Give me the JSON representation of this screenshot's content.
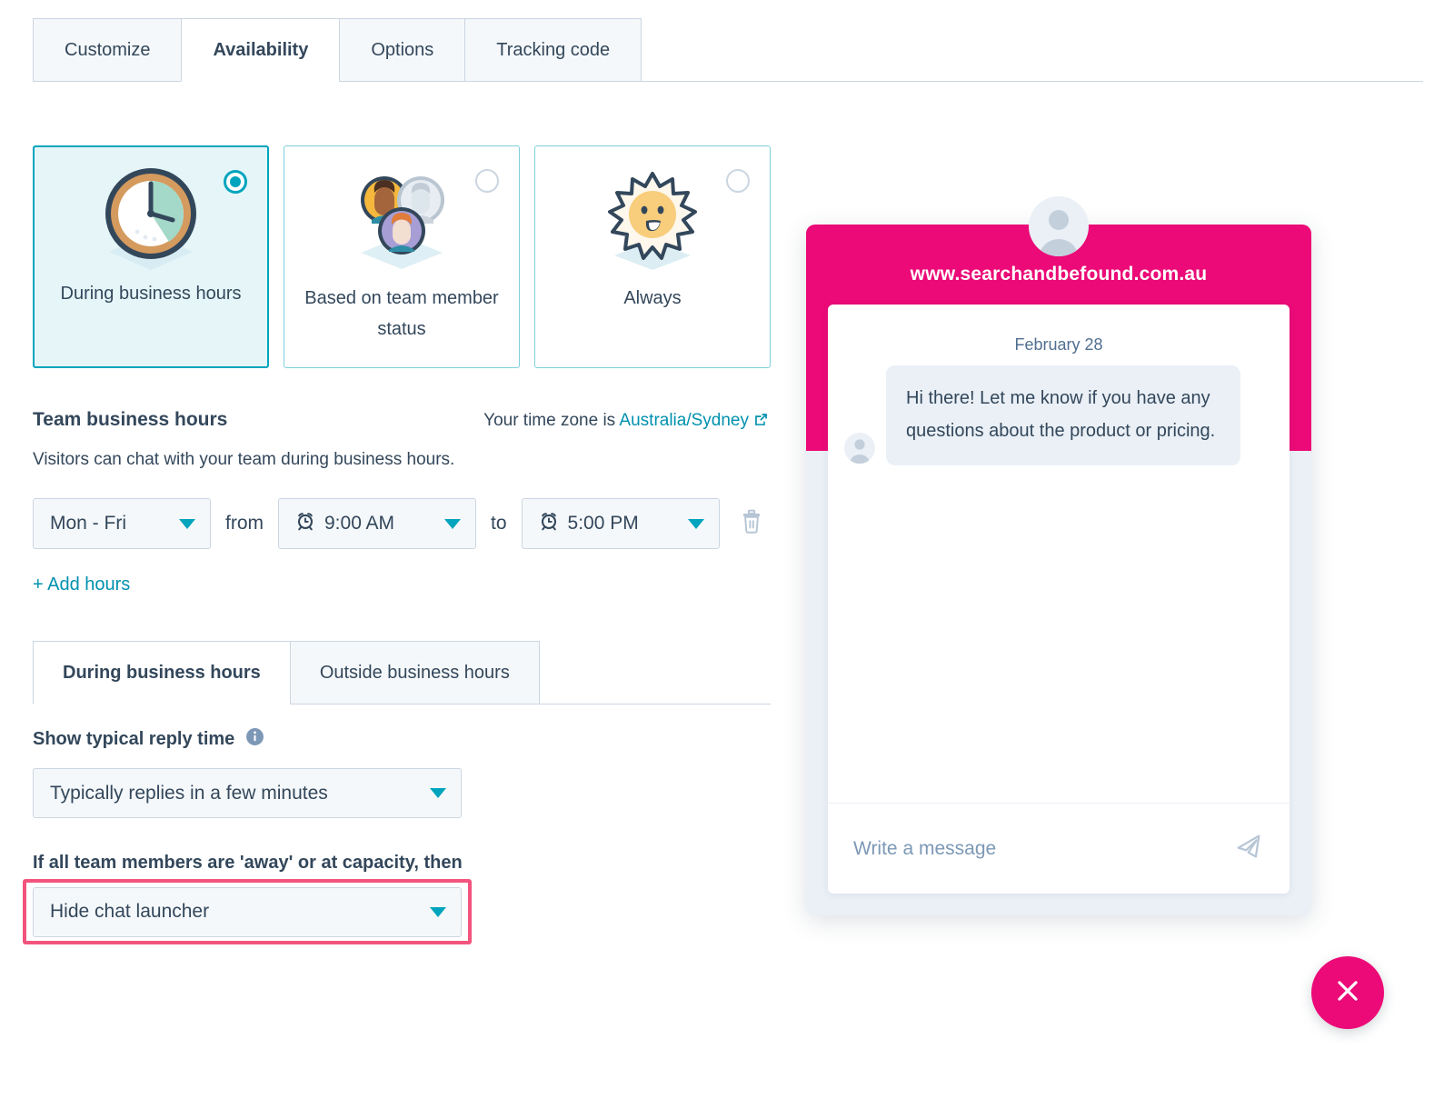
{
  "tabs": [
    {
      "label": "Customize",
      "active": false
    },
    {
      "label": "Availability",
      "active": true
    },
    {
      "label": "Options",
      "active": false
    },
    {
      "label": "Tracking code",
      "active": false
    }
  ],
  "availability_cards": [
    {
      "label": "During business hours",
      "icon": "clock-icon",
      "selected": true
    },
    {
      "label": "Based on team member status",
      "icon": "team-avatars-icon",
      "selected": false
    },
    {
      "label": "Always",
      "icon": "sun-icon",
      "selected": false
    }
  ],
  "business_hours": {
    "title": "Team business hours",
    "timezone_prefix": "Your time zone is ",
    "timezone_link": "Australia/Sydney",
    "subtitle": "Visitors can chat with your team during business hours.",
    "day_range": "Mon - Fri",
    "from_label": "from",
    "start_time": "9:00 AM",
    "to_label": "to",
    "end_time": "5:00 PM",
    "add_hours_label": "+ Add hours",
    "delete_icon": "trash-icon"
  },
  "sub_tabs": [
    {
      "label": "During business hours",
      "active": true
    },
    {
      "label": "Outside business hours",
      "active": false
    }
  ],
  "reply_time": {
    "label": "Show typical reply time",
    "info_icon": "info-icon",
    "value": "Typically replies in a few minutes"
  },
  "away_setting": {
    "label": "If all team members are 'away' or at capacity, then",
    "value": "Hide chat launcher",
    "highlight_color": "#f2547d"
  },
  "chat_preview": {
    "url": "www.searchandbefound.com.au",
    "header_color": "#eb0a77",
    "avatar_icon": "user-avatar-icon",
    "date": "February 28",
    "message": "Hi there! Let me know if you have any questions about the product or pricing.",
    "input_placeholder": "Write a message",
    "send_icon": "send-icon",
    "launcher_icon": "close-icon"
  }
}
